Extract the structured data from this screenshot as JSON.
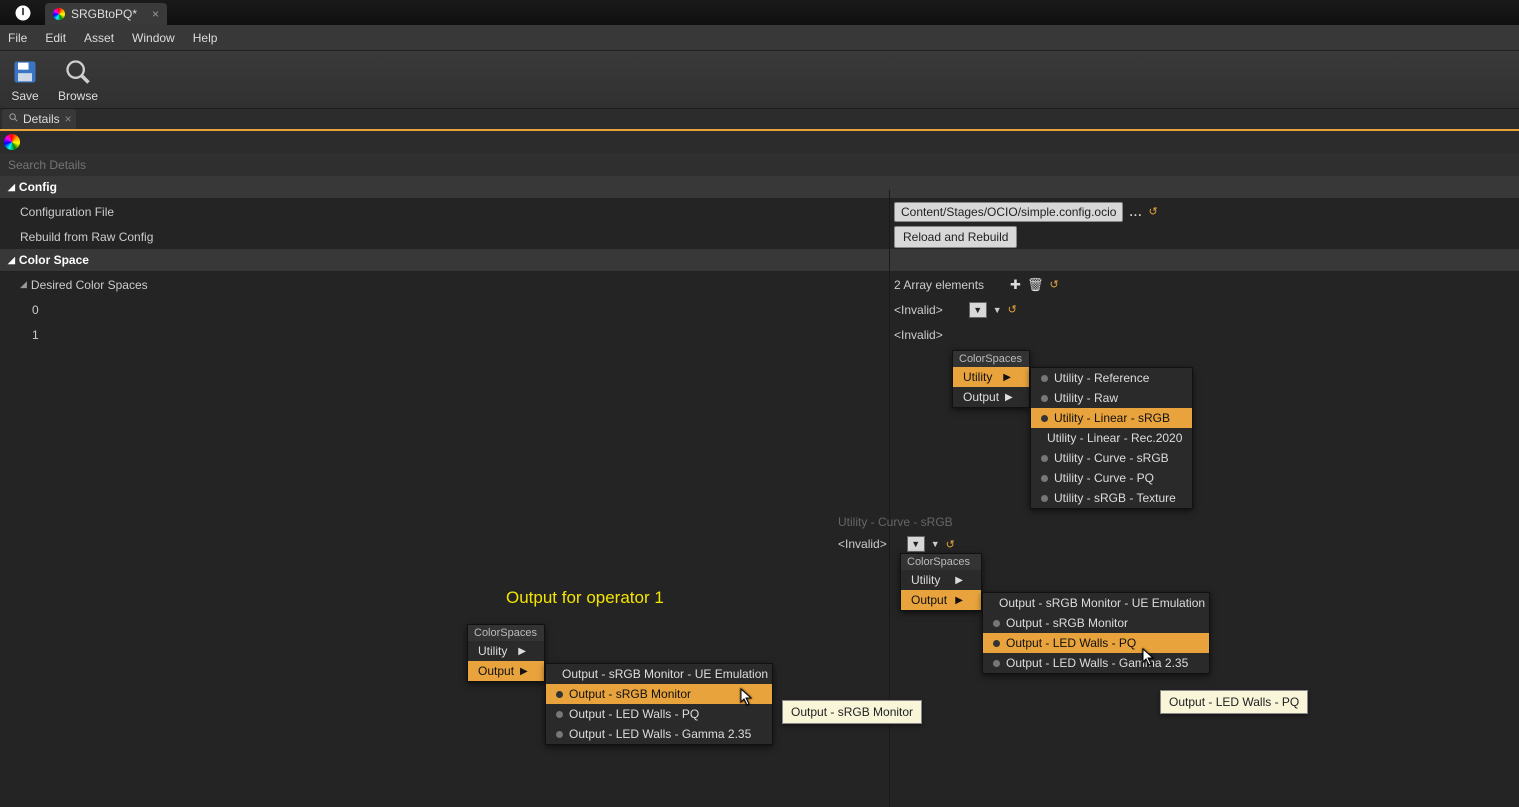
{
  "tab_title": "SRGBtoPQ*",
  "menu": {
    "file": "File",
    "edit": "Edit",
    "asset": "Asset",
    "window": "Window",
    "help": "Help"
  },
  "toolbar": {
    "save": "Save",
    "browse": "Browse"
  },
  "details_tab": "Details",
  "search_placeholder": "Search Details",
  "config": {
    "header": "Config",
    "config_file_label": "Configuration File",
    "config_file_value": "Content/Stages/OCIO/simple.config.ocio",
    "rebuild_label": "Rebuild from Raw Config",
    "rebuild_btn": "Reload and Rebuild"
  },
  "colorspace": {
    "header": "Color Space",
    "desired_label": "Desired Color Spaces",
    "array_count": "2 Array elements",
    "idx0": "0",
    "idx1": "1",
    "invalid": "<Invalid>"
  },
  "ghost_text": "Utility - Curve - sRGB",
  "menu1": {
    "header": "ColorSpaces",
    "utility": "Utility",
    "output": "Output",
    "sub": {
      "ref": "Utility - Reference",
      "raw": "Utility - Raw",
      "lin_srgb": "Utility - Linear - sRGB",
      "lin_2020": "Utility - Linear - Rec.2020",
      "curve_srgb": "Utility - Curve - sRGB",
      "curve_pq": "Utility - Curve - PQ",
      "srgb_tex": "Utility - sRGB - Texture"
    }
  },
  "row2_invalid": "<Invalid>",
  "menu2": {
    "header": "ColorSpaces",
    "utility": "Utility",
    "output": "Output",
    "sub": {
      "ue": "Output - sRGB Monitor - UE Emulation",
      "srgb": "Output - sRGB Monitor",
      "led_pq": "Output - LED Walls - PQ",
      "led_g": "Output - LED Walls - Gamma 2.35"
    }
  },
  "tooltip2": "Output - LED Walls - PQ",
  "yellow_label": "Output for operator 1",
  "menu3": {
    "header": "ColorSpaces",
    "utility": "Utility",
    "output": "Output",
    "sub": {
      "ue": "Output - sRGB Monitor - UE Emulation",
      "srgb": "Output - sRGB Monitor",
      "led_pq": "Output - LED Walls - PQ",
      "led_g": "Output - LED Walls - Gamma 2.35"
    }
  },
  "tooltip3": "Output - sRGB Monitor"
}
